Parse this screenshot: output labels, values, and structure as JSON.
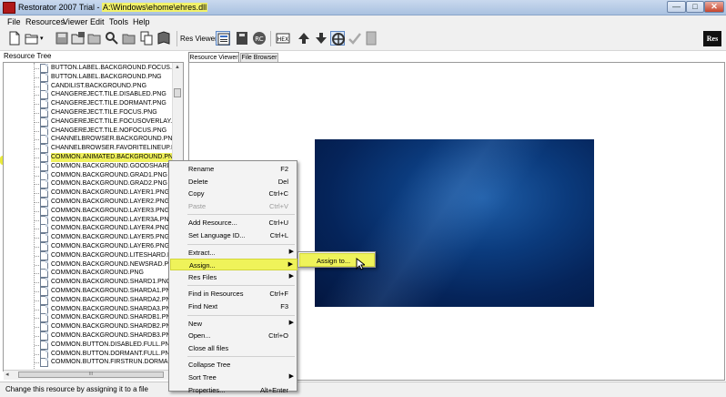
{
  "window": {
    "title_prefix": "Restorator 2007 Trial - ",
    "title_path": "A:\\Windows\\ehome\\ehres.dll",
    "min_glyph": "—",
    "max_glyph": "□",
    "close_glyph": "✕"
  },
  "menubar": [
    "File",
    "Resources",
    "Viewer",
    "Edit",
    "Tools",
    "Help"
  ],
  "toolbar": {
    "res_viewer_label": "Res Viewer:",
    "logo_text": "Res"
  },
  "left_panel": {
    "header": "Resource Tree",
    "tree_items": [
      "BUTTON.LABEL.BACKGROUND.FOCUS.PNG",
      "BUTTON.LABEL.BACKGROUND.PNG",
      "CANDILIST.BACKGROUND.PNG",
      "CHANGEREJECT.TILE.DISABLED.PNG",
      "CHANGEREJECT.TILE.DORMANT.PNG",
      "CHANGEREJECT.TILE.FOCUS.PNG",
      "CHANGEREJECT.TILE.FOCUSOVERLAY.PNG",
      "CHANGEREJECT.TILE.NOFOCUS.PNG",
      "CHANNELBROWSER.BACKGROUND.PNG",
      "CHANNELBROWSER.FAVORITELINEUP.ICO",
      "COMMON.ANIMATED.BACKGROUND.PNG",
      "COMMON.BACKGROUND.GOODSHARD.PNG",
      "COMMON.BACKGROUND.GRAD1.PNG",
      "COMMON.BACKGROUND.GRAD2.PNG",
      "COMMON.BACKGROUND.LAYER1.PNG",
      "COMMON.BACKGROUND.LAYER2.PNG",
      "COMMON.BACKGROUND.LAYER3.PNG",
      "COMMON.BACKGROUND.LAYER3A.PNG",
      "COMMON.BACKGROUND.LAYER4.PNG",
      "COMMON.BACKGROUND.LAYER5.PNG",
      "COMMON.BACKGROUND.LAYER6.PNG",
      "COMMON.BACKGROUND.LITESHARD.PNG",
      "COMMON.BACKGROUND.NEWSRAD.PNG",
      "COMMON.BACKGROUND.PNG",
      "COMMON.BACKGROUND.SHARD1.PNG",
      "COMMON.BACKGROUND.SHARDA1.PNG",
      "COMMON.BACKGROUND.SHARDA2.PNG",
      "COMMON.BACKGROUND.SHARDA3.PNG",
      "COMMON.BACKGROUND.SHARDB1.PNG",
      "COMMON.BACKGROUND.SHARDB2.PNG",
      "COMMON.BACKGROUND.SHARDB3.PNG",
      "COMMON.BUTTON.DISABLED.FULL.PNG",
      "COMMON.BUTTON.DORMANT.FULL.PNG",
      "COMMON.BUTTON.FIRSTRUN.DORMANT.PNG"
    ],
    "selected_index": 10,
    "hscroll_thumb_glyph": "III"
  },
  "right_panel": {
    "tabs": [
      "Resource Viewer",
      "File Browser"
    ]
  },
  "context_menu": {
    "items": [
      {
        "label": "Rename",
        "shortcut": "F2"
      },
      {
        "label": "Delete",
        "shortcut": "Del"
      },
      {
        "label": "Copy",
        "shortcut": "Ctrl+C"
      },
      {
        "label": "Paste",
        "shortcut": "Ctrl+V",
        "disabled": true
      },
      {
        "label": "Add Resource...",
        "shortcut": "Ctrl+U"
      },
      {
        "label": "Set Language ID...",
        "shortcut": "Ctrl+L"
      },
      {
        "label": "Extract...",
        "submenu": true
      },
      {
        "label": "Assign...",
        "submenu": true,
        "highlighted": true
      },
      {
        "label": "Res Files",
        "submenu": true
      },
      {
        "label": "Find in Resources",
        "shortcut": "Ctrl+F"
      },
      {
        "label": "Find Next",
        "shortcut": "F3"
      },
      {
        "label": "New",
        "submenu": true
      },
      {
        "label": "Open...",
        "shortcut": "Ctrl+O"
      },
      {
        "label": "Close all files"
      },
      {
        "label": "Collapse Tree"
      },
      {
        "label": "Sort Tree",
        "submenu": true
      },
      {
        "label": "Properties...",
        "shortcut": "Alt+Enter"
      }
    ],
    "submenu_item": "Assign to...",
    "arrow_glyph": "▶"
  },
  "statusbar": {
    "text": "Change this resource by assigning it to a file"
  },
  "colors": {
    "highlight": "#eff35a",
    "titlebar": "#b9cee9",
    "preview_blue": "#0b3b7d"
  }
}
